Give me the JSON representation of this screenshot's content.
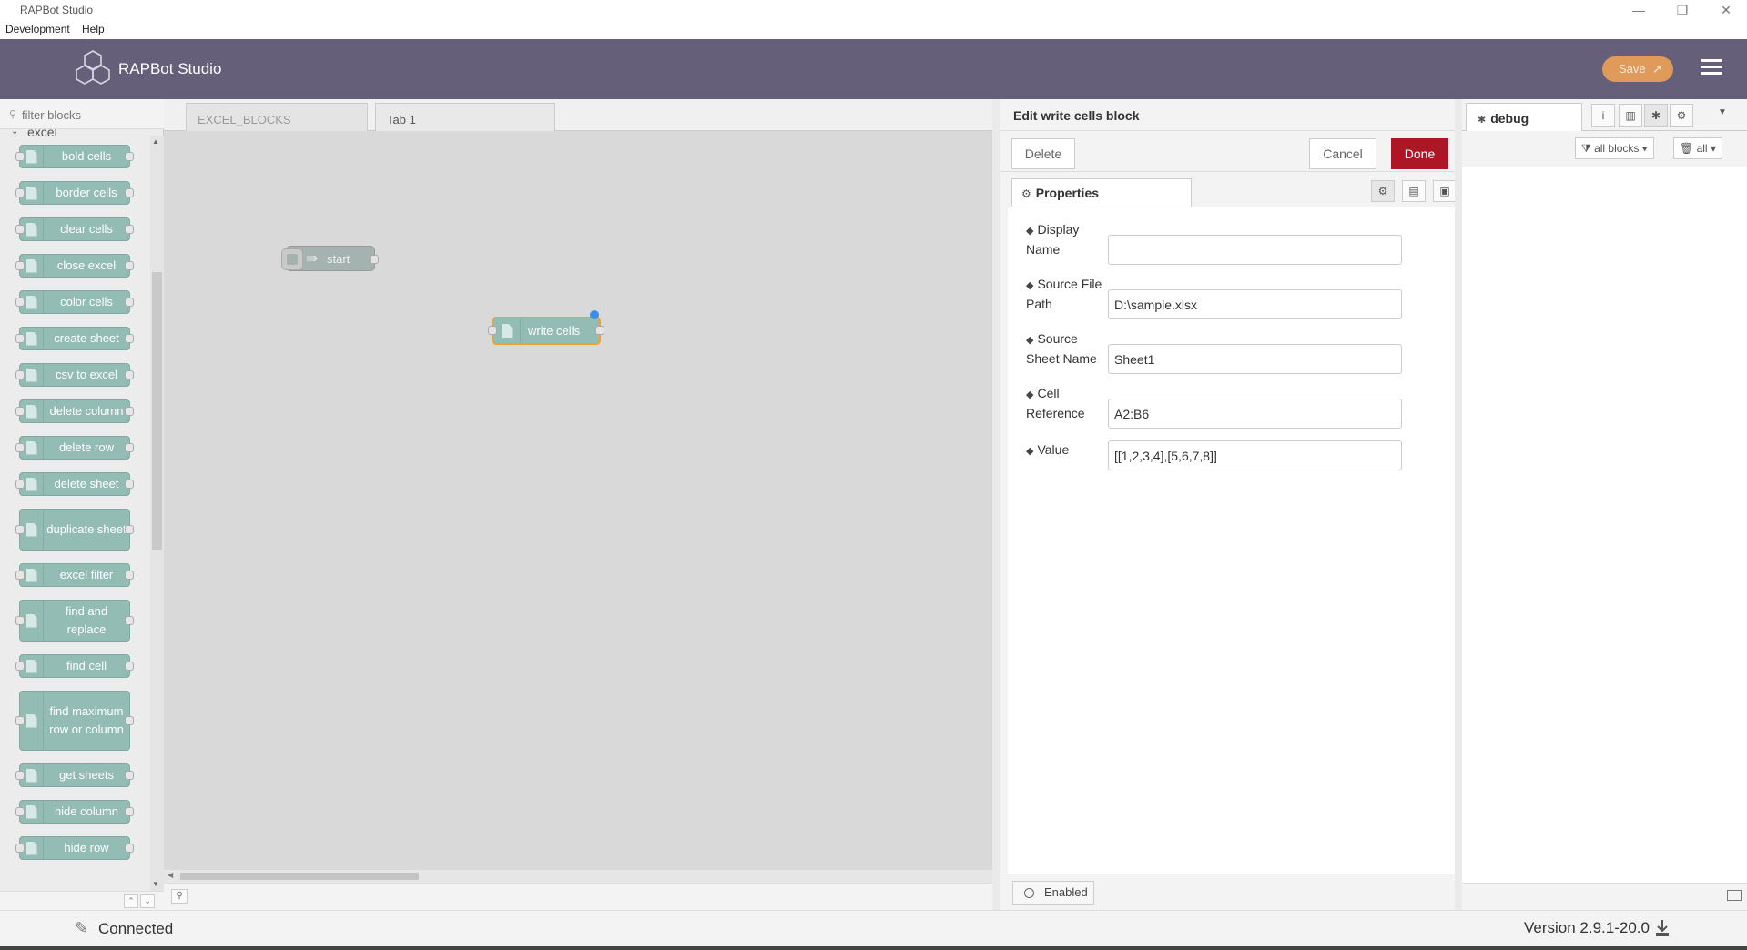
{
  "window": {
    "title": "RAPBot Studio",
    "controls": [
      "—",
      "❐",
      "✕"
    ]
  },
  "menubar": {
    "items": [
      "Development",
      "Help"
    ]
  },
  "header": {
    "brand": "RAPBot Studio",
    "save_label": "Save",
    "accent": "#655f7a",
    "save_color": "#e09a5a"
  },
  "palette": {
    "filter_placeholder": "filter blocks",
    "category": "excel",
    "blocks": [
      "bold cells",
      "border cells",
      "clear cells",
      "close excel",
      "color cells",
      "create sheet",
      "csv to excel",
      "delete column",
      "delete row",
      "delete sheet",
      "duplicate sheet",
      "excel filter",
      "find and replace",
      "find cell",
      "find maximum row or column",
      "get sheets",
      "hide column",
      "hide row"
    ]
  },
  "workspace": {
    "tabs": [
      "EXCEL_BLOCKS",
      "Tab 1"
    ],
    "active_tab": "Tab 1",
    "nodes": {
      "start": "start",
      "write": "write cells"
    }
  },
  "editor": {
    "title": "Edit write cells block",
    "delete_label": "Delete",
    "cancel_label": "Cancel",
    "done_label": "Done",
    "tab_label": "Properties",
    "fields": {
      "display_name": {
        "label_1": "Display",
        "label_2": "Name",
        "value": ""
      },
      "source_file": {
        "label_1": "Source File",
        "label_2": "Path",
        "value": "D:\\sample.xlsx"
      },
      "sheet_name": {
        "label_1": "Source",
        "label_2": "Sheet Name",
        "value": "Sheet1"
      },
      "cell_ref": {
        "label_1": "Cell",
        "label_2": "Reference",
        "value": "A2:B6"
      },
      "value": {
        "label_1": "Value",
        "value": "[[1,2,3,4],[5,6,7,8]]"
      }
    },
    "enabled_label": "Enabled",
    "done_color": "#ad1625"
  },
  "sidebar": {
    "tab_label": "debug",
    "filter_label": "all blocks",
    "clear_label": "all"
  },
  "status": {
    "connection": "Connected",
    "version": "Version 2.9.1-20.0"
  }
}
